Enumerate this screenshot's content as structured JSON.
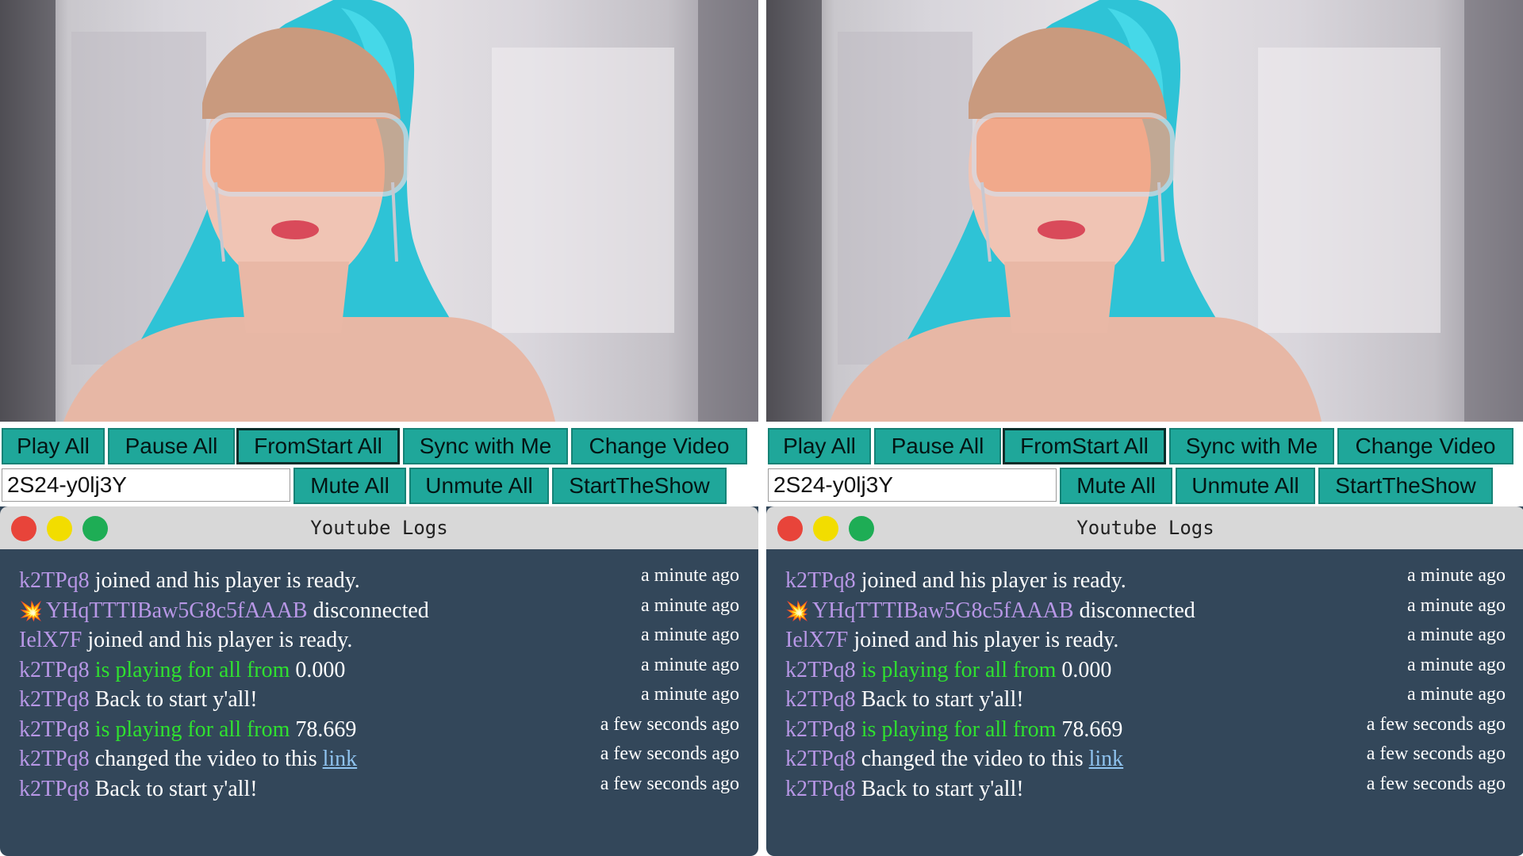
{
  "colors": {
    "button_bg": "#1fa79a",
    "log_bg": "#33475a",
    "titlebar_bg": "#d8d8d8",
    "user_color": "#b897e6",
    "playing_color": "#2fe12f",
    "link_color": "#8fc3ef"
  },
  "panels": [
    {
      "controls": {
        "play_all": "Play All",
        "pause_all": "Pause All",
        "from_start_all": "FromStart All",
        "sync_with_me": "Sync with Me",
        "change_video": "Change Video",
        "video_id": "2S24-y0lj3Y",
        "mute_all": "Mute All",
        "unmute_all": "Unmute All",
        "start_the_show": "StartTheShow"
      },
      "log_window": {
        "title": "Youtube  Logs",
        "logs": [
          {
            "user": "k2TPq8",
            "text": "joined and his player is ready.",
            "time": "a minute ago"
          },
          {
            "icon": "explosion-icon",
            "user": "YHqTTTIBaw5G8c5fAAAB",
            "text": "disconnected",
            "time": "a minute ago"
          },
          {
            "user": "IelX7F",
            "text": "joined and his player is ready.",
            "time": "a minute ago"
          },
          {
            "user": "k2TPq8",
            "action": "is playing for all from",
            "value": "0.000",
            "time": "a minute ago"
          },
          {
            "user": "k2TPq8",
            "text": "Back to start y'all!",
            "time": "a minute ago"
          },
          {
            "user": "k2TPq8",
            "action": "is playing for all from",
            "value": "78.669",
            "time": "a few seconds ago"
          },
          {
            "user": "k2TPq8",
            "text": "changed the video to this",
            "link": "link",
            "time": "a few seconds ago"
          },
          {
            "user": "k2TPq8",
            "text": "Back to start y'all!",
            "time": "a few seconds ago"
          }
        ]
      }
    },
    {
      "controls": {
        "play_all": "Play All",
        "pause_all": "Pause All",
        "from_start_all": "FromStart All",
        "sync_with_me": "Sync with Me",
        "change_video": "Change Video",
        "video_id": "2S24-y0lj3Y",
        "mute_all": "Mute All",
        "unmute_all": "Unmute All",
        "start_the_show": "StartTheShow"
      },
      "log_window": {
        "title": "Youtube  Logs",
        "logs": [
          {
            "user": "k2TPq8",
            "text": "joined and his player is ready.",
            "time": "a minute ago"
          },
          {
            "icon": "explosion-icon",
            "user": "YHqTTTIBaw5G8c5fAAAB",
            "text": "disconnected",
            "time": "a minute ago"
          },
          {
            "user": "IelX7F",
            "text": "joined and his player is ready.",
            "time": "a minute ago"
          },
          {
            "user": "k2TPq8",
            "action": "is playing for all from",
            "value": "0.000",
            "time": "a minute ago"
          },
          {
            "user": "k2TPq8",
            "text": "Back to start y'all!",
            "time": "a minute ago"
          },
          {
            "user": "k2TPq8",
            "action": "is playing for all from",
            "value": "78.669",
            "time": "a few seconds ago"
          },
          {
            "user": "k2TPq8",
            "text": "changed the video to this",
            "link": "link",
            "time": "a few seconds ago"
          },
          {
            "user": "k2TPq8",
            "text": "Back to start y'all!",
            "time": "a few seconds ago"
          }
        ]
      }
    }
  ]
}
